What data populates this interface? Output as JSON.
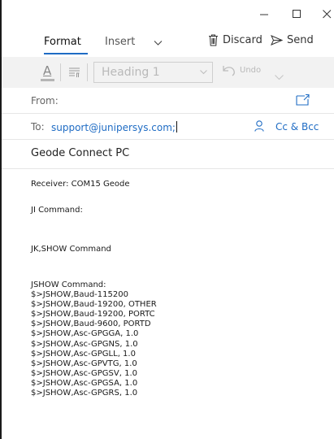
{
  "window": {
    "controls": [
      "minimize-icon",
      "maximize-icon",
      "close-icon"
    ]
  },
  "tabs": {
    "format": "Format",
    "insert": "Insert",
    "discard": "Discard",
    "send": "Send"
  },
  "toolbar": {
    "font_color_glyph": "A",
    "style_value": "Heading 1",
    "undo": "Undo"
  },
  "header": {
    "from_label": "From:",
    "to_label": "To:",
    "to_value": "support@junipersys.com;",
    "cc_bcc": "Cc & Bcc",
    "subject": "Geode Connect PC"
  },
  "body": {
    "receiver": "Receiver: COM15 Geode",
    "ji_command": "JI Command:",
    "jk_command": "JK,SHOW Command",
    "jshow_command": "JSHOW Command:",
    "jshow_lines": [
      "$>JSHOW,Baud-115200",
      "$>JSHOW,Baud-19200, OTHER",
      "$>JSHOW,Baud-19200, PORTC",
      "$>JSHOW,Baud-9600, PORTD",
      "$>JSHOW,Asc-GPGGA, 1.0",
      "$>JSHOW,Asc-GPGNS, 1.0",
      "$>JSHOW,Asc-GPGLL, 1.0",
      "$>JSHOW,Asc-GPVTG, 1.0",
      "$>JSHOW,Asc-GPGSV, 1.0",
      "$>JSHOW,Asc-GPGSA, 1.0",
      "$>JSHOW,Asc-GPGRS, 1.0"
    ]
  },
  "colors": {
    "accent": "#1f6cc4",
    "toolbar_bg": "#f2f2f2",
    "disabled": "#b9b9b9"
  }
}
